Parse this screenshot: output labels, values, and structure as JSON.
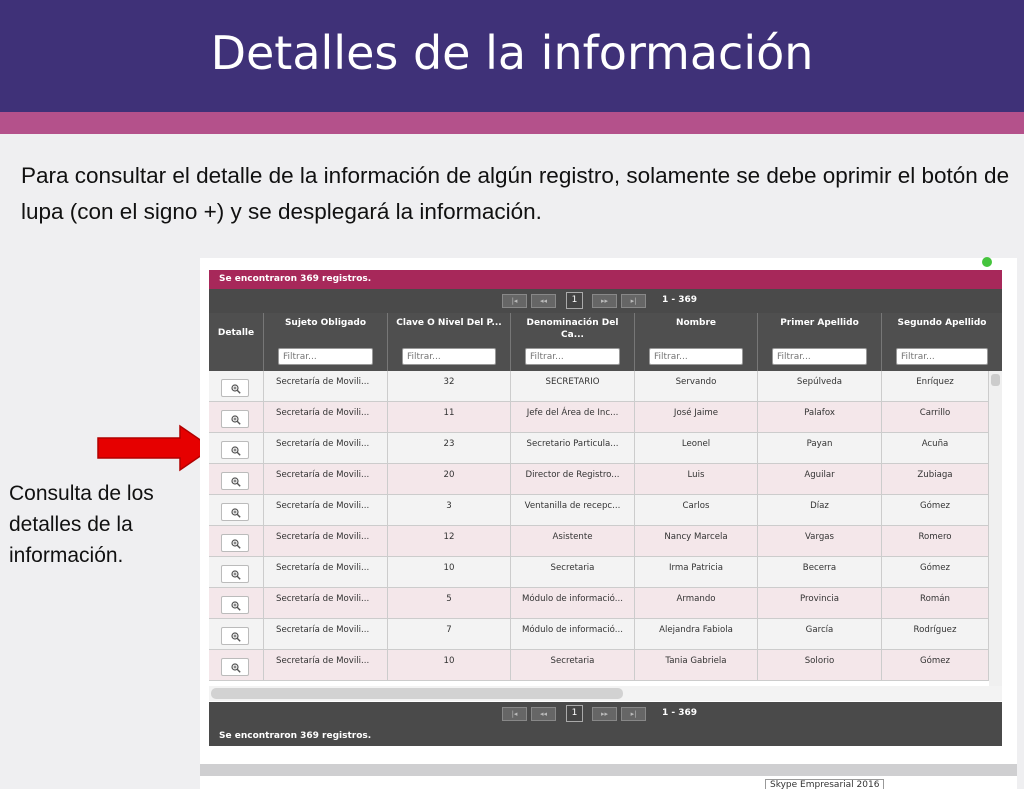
{
  "slide": {
    "title": "Detalles de la información",
    "intro": "Para consultar el detalle de la información de algún registro, solamente se debe oprimir el botón de lupa (con el signo +) y se desplegará la información.",
    "side_note": "Consulta de los detalles de la información.",
    "footer_tag": "Skype Empresarial 2016"
  },
  "colors": {
    "title_bar": "#3f3178",
    "pink_strip": "#b4518b",
    "records_bar": "#a7285a",
    "arrow": "#e60000"
  },
  "app": {
    "records_found": "Se encontraron 369 registros.",
    "pager": {
      "first": "|◂",
      "prev": "◂◂",
      "page": "1",
      "next": "▸▸",
      "last": "▸|",
      "range": "1 - 369"
    },
    "columns": [
      {
        "label": "Detalle",
        "filter": false
      },
      {
        "label": "Sujeto Obligado",
        "filter": true
      },
      {
        "label": "Clave O Nivel Del P...",
        "filter": true
      },
      {
        "label": "Denominación Del Ca...",
        "filter": true
      },
      {
        "label": "Nombre",
        "filter": true
      },
      {
        "label": "Primer Apellido",
        "filter": true
      },
      {
        "label": "Segundo Apellido",
        "filter": true
      }
    ],
    "filter_placeholder": "Filtrar...",
    "rows": [
      {
        "sujeto": "Secretaría de Movili...",
        "clave": "32",
        "denominacion": "SECRETARIO",
        "nombre": "Servando",
        "primer": "Sepúlveda",
        "segundo": "Enríquez"
      },
      {
        "sujeto": "Secretaría de Movili...",
        "clave": "11",
        "denominacion": "Jefe del Área de Inc...",
        "nombre": "José Jaime",
        "primer": "Palafox",
        "segundo": "Carrillo"
      },
      {
        "sujeto": "Secretaría de Movili...",
        "clave": "23",
        "denominacion": "Secretario Particula...",
        "nombre": "Leonel",
        "primer": "Payan",
        "segundo": "Acuña"
      },
      {
        "sujeto": "Secretaría de Movili...",
        "clave": "20",
        "denominacion": "Director de Registro...",
        "nombre": "Luis",
        "primer": "Aguilar",
        "segundo": "Zubiaga"
      },
      {
        "sujeto": "Secretaría de Movili...",
        "clave": "3",
        "denominacion": "Ventanilla de recepc...",
        "nombre": "Carlos",
        "primer": "Díaz",
        "segundo": "Gómez"
      },
      {
        "sujeto": "Secretaría de Movili...",
        "clave": "12",
        "denominacion": "Asistente",
        "nombre": "Nancy Marcela",
        "primer": "Vargas",
        "segundo": "Romero"
      },
      {
        "sujeto": "Secretaría de Movili...",
        "clave": "10",
        "denominacion": "Secretaria",
        "nombre": "Irma Patricia",
        "primer": "Becerra",
        "segundo": "Gómez"
      },
      {
        "sujeto": "Secretaría de Movili...",
        "clave": "5",
        "denominacion": "Módulo de informació...",
        "nombre": "Armando",
        "primer": "Provincia",
        "segundo": "Román"
      },
      {
        "sujeto": "Secretaría de Movili...",
        "clave": "7",
        "denominacion": "Módulo de informació...",
        "nombre": "Alejandra Fabiola",
        "primer": "García",
        "segundo": "Rodríguez"
      },
      {
        "sujeto": "Secretaría de Movili...",
        "clave": "10",
        "denominacion": "Secretaria",
        "nombre": "Tania Gabriela",
        "primer": "Solorio",
        "segundo": "Gómez"
      }
    ]
  }
}
